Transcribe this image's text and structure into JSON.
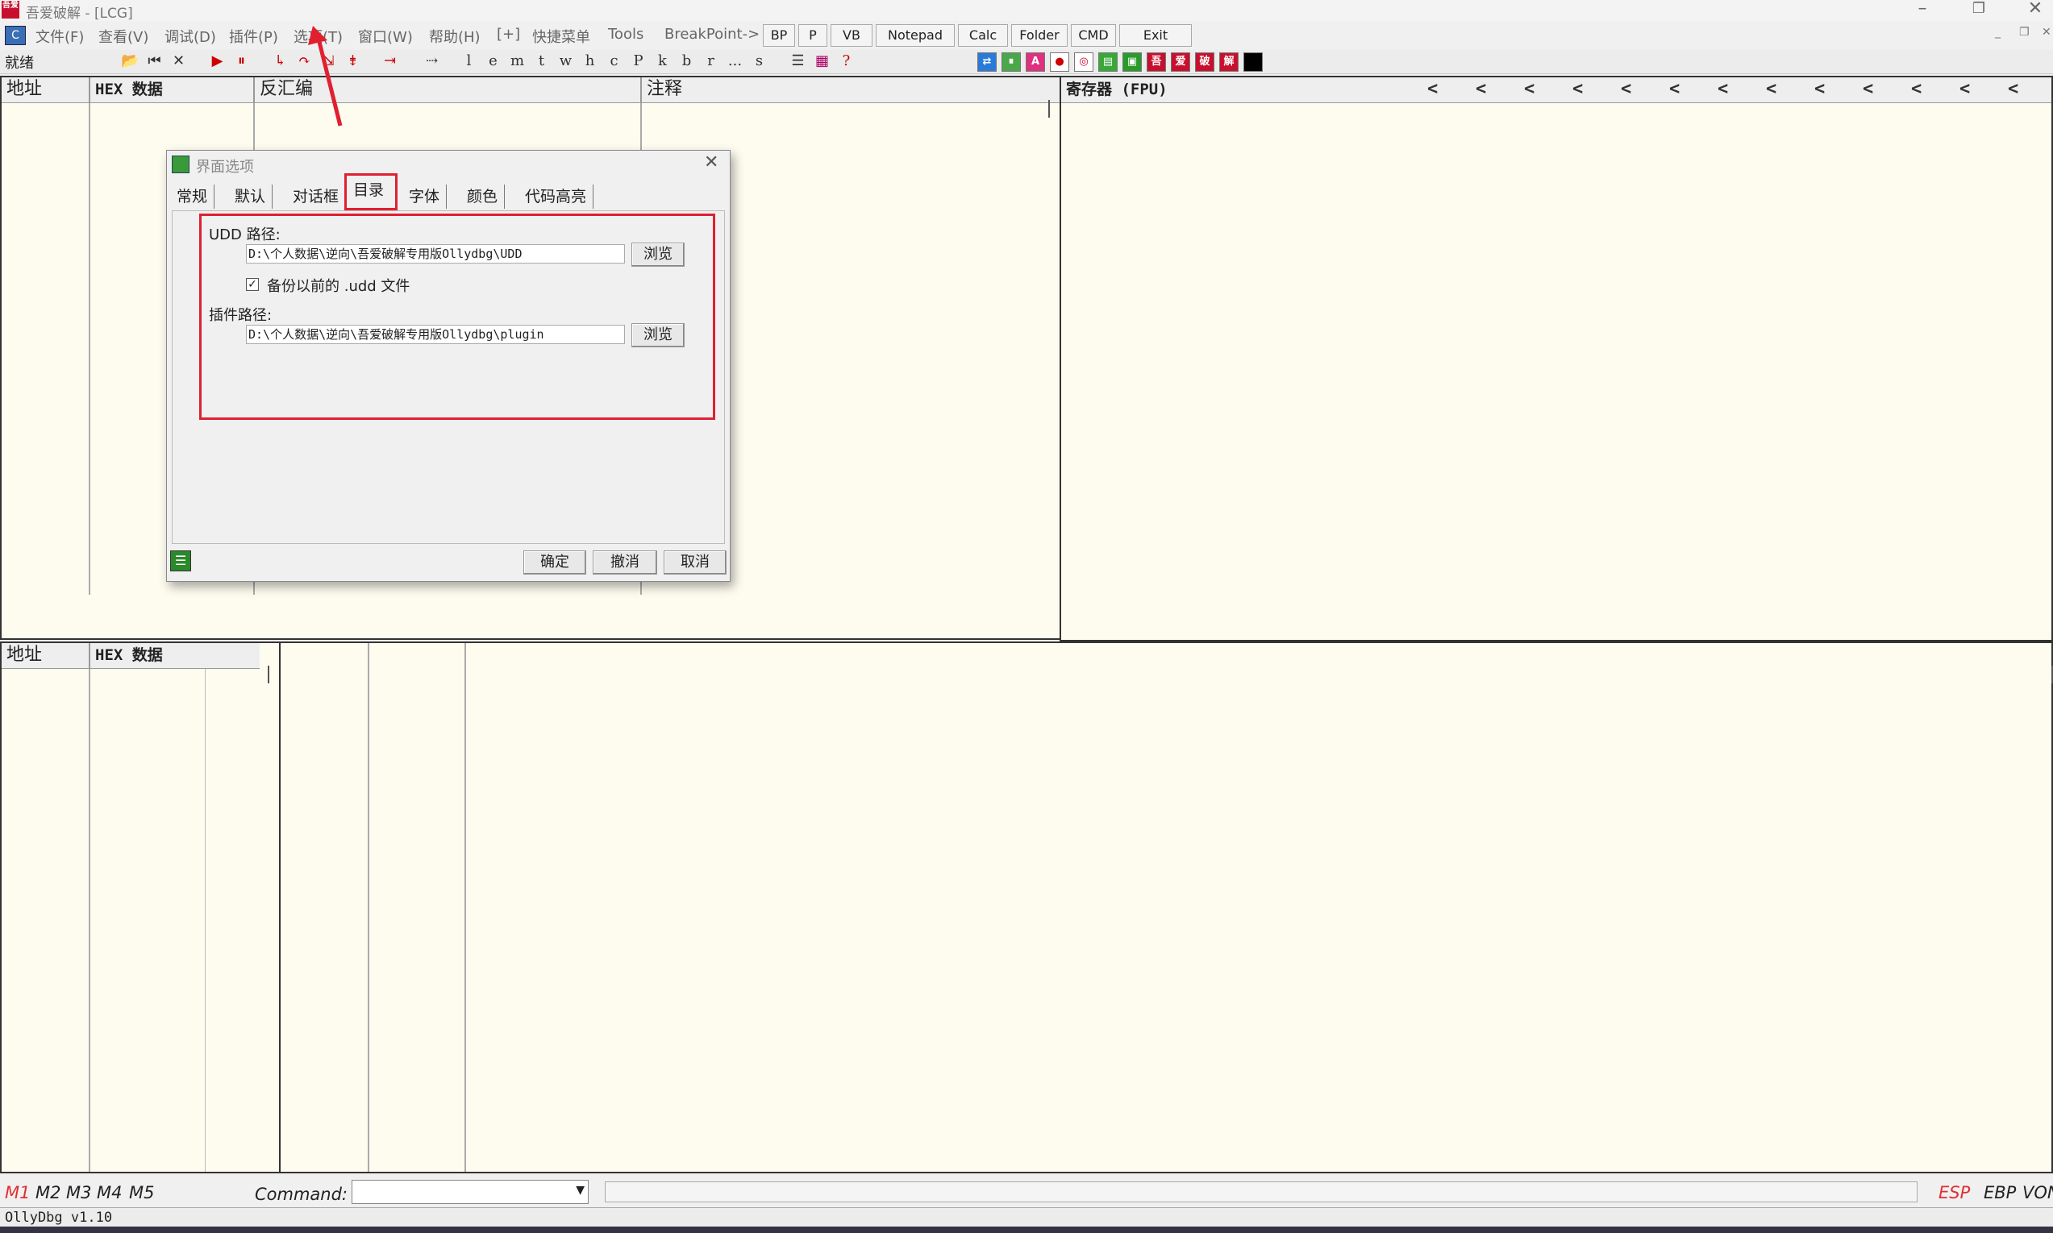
{
  "window": {
    "title": "吾爱破解 - [LCG]",
    "app_icon": "吾爱"
  },
  "menu": {
    "items": [
      "文件(F)",
      "查看(V)",
      "调试(D)",
      "插件(P)",
      "选项(T)",
      "窗口(W)",
      "帮助(H)",
      "[+]",
      "快捷菜单",
      "Tools",
      "BreakPoint->"
    ],
    "buttons": [
      "BP",
      "P",
      "VB",
      "Notepad",
      "Calc",
      "Folder",
      "CMD",
      "Exit"
    ]
  },
  "toolbar": {
    "status": "就绪",
    "letters": [
      "l",
      "e",
      "m",
      "t",
      "w",
      "h",
      "c",
      "P",
      "k",
      "b",
      "r",
      "...",
      "s"
    ],
    "right_icons": [
      "吾",
      "爱",
      "破",
      "解"
    ]
  },
  "cpu": {
    "headers": [
      "地址",
      "HEX 数据",
      "反汇编",
      "注释"
    ],
    "registers_header": "寄存器 (FPU)",
    "arrows": "<"
  },
  "dump": {
    "headers": [
      "地址",
      "HEX 数据"
    ]
  },
  "dialog": {
    "title": "界面选项",
    "tabs": [
      "常规",
      "默认",
      "对话框",
      "目录",
      "字体",
      "颜色",
      "代码高亮"
    ],
    "udd_label": "UDD 路径:",
    "udd_path": "D:\\个人数据\\逆向\\吾爱破解专用版Ollydbg\\UDD",
    "browse": "浏览",
    "backup_label": "备份以前的 .udd 文件",
    "backup_checked": true,
    "plugin_label": "插件路径:",
    "plugin_path": "D:\\个人数据\\逆向\\吾爱破解专用版Ollydbg\\plugin",
    "ok": "确定",
    "undo": "撤消",
    "cancel": "取消"
  },
  "status": {
    "m_buttons": [
      "M1",
      "M2",
      "M3",
      "M4",
      "M5"
    ],
    "command_label": "Command:",
    "regs": [
      "ESP",
      "EBP",
      "VON"
    ]
  },
  "footer": {
    "version": "OllyDbg v1.10"
  },
  "colors": {
    "pane_bg": "#fefcef",
    "highlight": "#e02030",
    "accent_m1": "#e03030"
  }
}
